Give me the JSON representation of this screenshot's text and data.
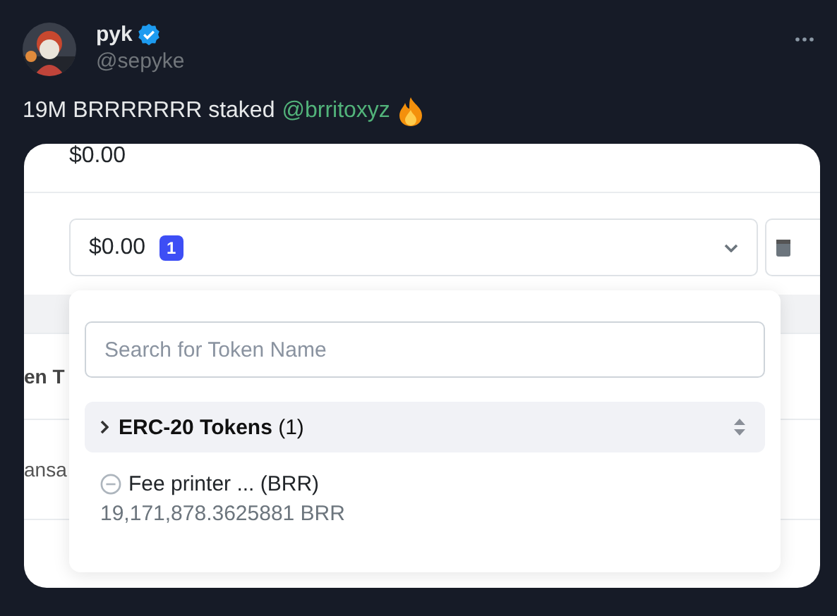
{
  "post": {
    "author": {
      "name": "pyk",
      "verified": true,
      "handle": "@sepyke"
    },
    "text": "19M BRRRRRRR staked",
    "mention": "@brritoxyz"
  },
  "screenshot": {
    "balance": "$0.00",
    "token_select": {
      "value": "$0.00",
      "count": "1"
    },
    "side_texts": [
      "en T",
      "ansa"
    ],
    "dropdown": {
      "search_placeholder": "Search for Token Name",
      "group": {
        "title": "ERC-20 Tokens",
        "count": "(1)"
      },
      "tokens": [
        {
          "name": "Fee printer ... (BRR)",
          "amount": "19,171,878.3625881 BRR"
        }
      ]
    }
  }
}
